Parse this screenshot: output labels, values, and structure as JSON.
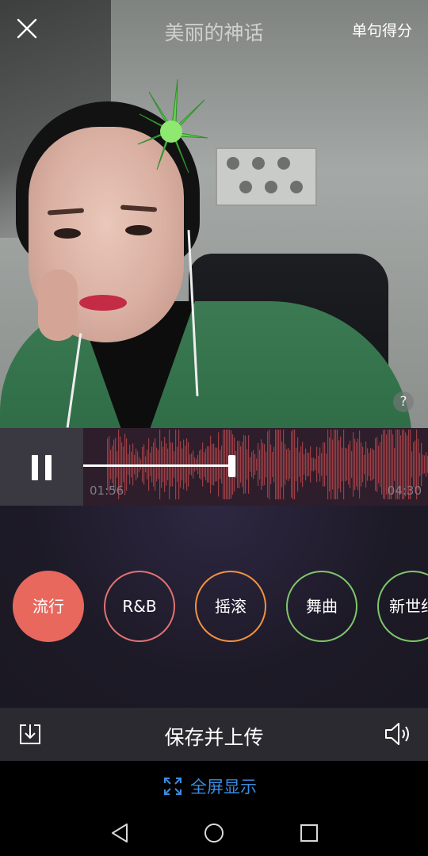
{
  "header": {
    "song_title": "美丽的神话",
    "score_label": "单句得分",
    "help_label": "?"
  },
  "player": {
    "state": "playing",
    "current_time": "01:56",
    "total_time": "04:30",
    "progress_fraction": 0.43,
    "waveform_color": "#c14a4e"
  },
  "styles": {
    "items": [
      {
        "label": "流行",
        "color": "#e8685e",
        "active": true
      },
      {
        "label": "R&B",
        "color": "#e17273",
        "active": false
      },
      {
        "label": "摇滚",
        "color": "#f2923f",
        "active": false
      },
      {
        "label": "舞曲",
        "color": "#7fc56b",
        "active": false
      },
      {
        "label": "新世纪",
        "color": "#7fc56b",
        "active": false
      }
    ]
  },
  "save_bar": {
    "save_label": "保存并上传"
  },
  "fullscreen": {
    "label": "全屏显示",
    "color": "#3a8de0"
  },
  "nav": {
    "icons": [
      "back-icon",
      "home-icon",
      "recents-icon"
    ]
  }
}
